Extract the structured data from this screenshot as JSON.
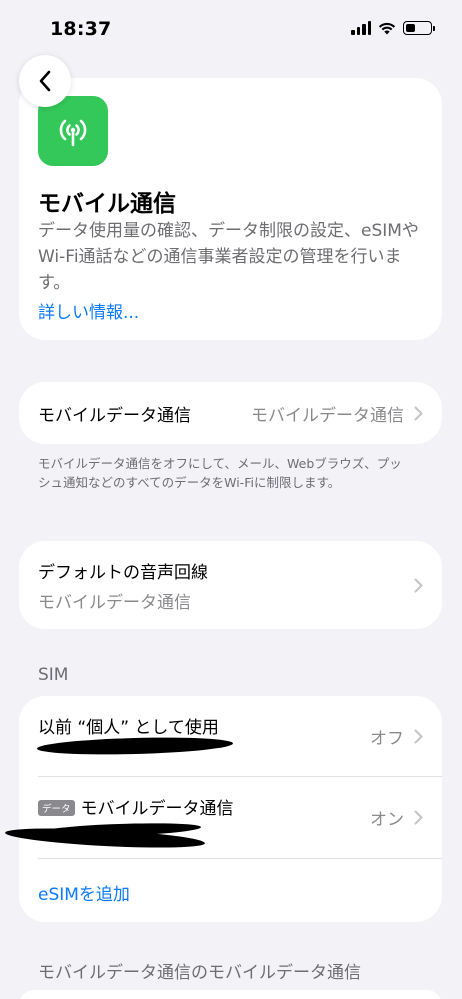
{
  "status_bar": {
    "time": "18:37"
  },
  "nav": {
    "back_icon": "chevron-left-icon"
  },
  "info": {
    "icon": "antenna-icon",
    "title": "モバイル通信",
    "description": "データ使用量の確認、データ制限の設定、eSIMやWi-Fi通話などの通信事業者設定の管理を行います。",
    "link": "詳しい情報..."
  },
  "cellular_data": {
    "label": "モバイルデータ通信",
    "value": "モバイルデータ通信",
    "footnote": "モバイルデータ通信をオフにして、メール、Webブラウズ、プッシュ通知などのすべてのデータをWi-Fiに制限します。"
  },
  "default_voice": {
    "label": "デフォルトの音声回線",
    "value": "モバイルデータ通信"
  },
  "sim": {
    "header": "SIM",
    "lines": [
      {
        "label": "以前 “個人” として使用",
        "status": "オフ"
      },
      {
        "tag": "データ",
        "label": "モバイルデータ通信",
        "status": "オン"
      }
    ],
    "add_esim": "eSIMを追加"
  },
  "usage": {
    "header": "モバイルデータ通信のモバイルデータ通信"
  },
  "colors": {
    "accent": "#0a7aff",
    "app_icon": "#34c759",
    "background": "#f2f2f7"
  }
}
